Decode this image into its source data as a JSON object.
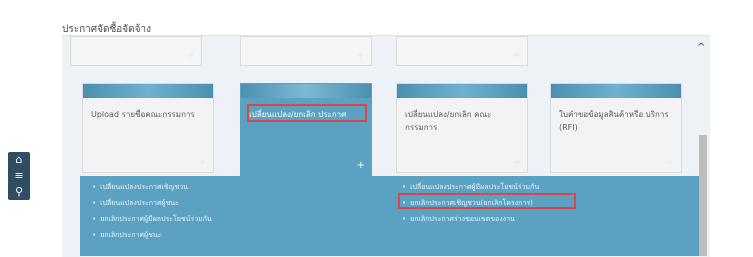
{
  "page": {
    "header": "ประกาศจัดซื้อจัดจ้าง"
  },
  "top_tiles": [
    {
      "plus": "+"
    },
    {
      "plus": "+"
    },
    {
      "plus": "+"
    }
  ],
  "tiles": [
    {
      "label": "Upload รายชื่อคณะกรรมการ",
      "plus": "+"
    },
    {
      "label": "เปลี่ยนแปลง/ยกเลิก ประกาศ",
      "plus": "+"
    },
    {
      "label": "เปลี่ยนแปลง/ยกเลิก คณะ กรรมการ",
      "plus": "+"
    },
    {
      "label": "ใบคำขอข้อมูลสินค้าหรือ บริการ (RFI)",
      "plus": "+"
    }
  ],
  "sub_menu": {
    "left": [
      "เปลี่ยนแปลงประกาศเชิญชวน",
      "เปลี่ยนแปลงประกาศผู้ชนะ",
      "ยกเลิกประกาศผู้มีผลประโยชน์ร่วมกัน",
      "ยกเลิกประกาศผู้ชนะ"
    ],
    "right": [
      "เปลี่ยนแปลงประกาศผู้มีผลประโยชน์ร่วมกัน",
      "ยกเลิกประกาศเชิญชวน(ยกเลิกโครงการ)",
      "ยกเลิกประกาศร่างขอบเขตของงาน"
    ]
  },
  "sidebar": {
    "home_glyph": "⌂",
    "menu_glyph": "≡",
    "search_glyph": "⚲"
  },
  "scroll": {
    "up_glyph": "^"
  },
  "colors": {
    "accent": "#5aa1c2",
    "highlight": "#d8474a",
    "sidebar": "#2f4e63"
  }
}
